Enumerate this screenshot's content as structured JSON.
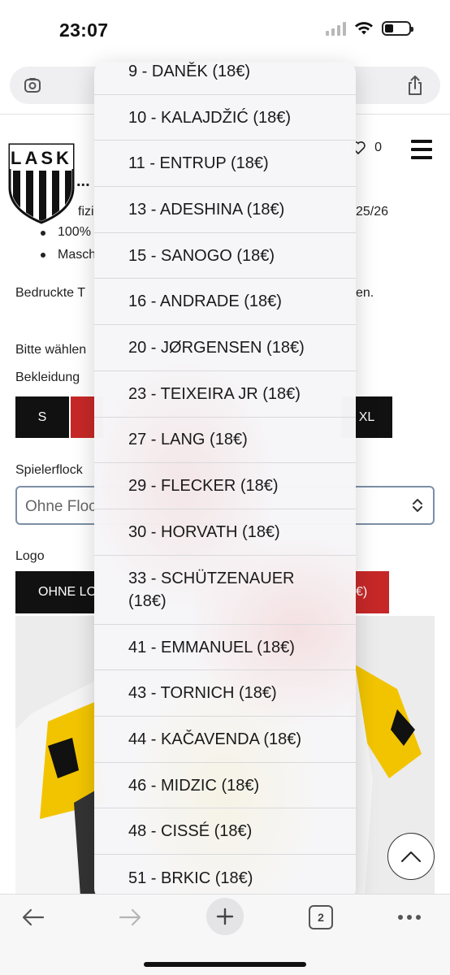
{
  "status_bar": {
    "time": "23:07",
    "battery_level": 0.35
  },
  "header": {
    "logo_text": "LASK",
    "favorites_count": "0"
  },
  "background_page": {
    "heading_fragment": "...",
    "spec_line_1_start": "fizie",
    "spec_line_1_end": "25/26",
    "spec_line_2_start": "100%",
    "spec_line_3_start": "Masch",
    "note_start": "Bedruckte T",
    "note_end": "en.",
    "choose_label": "Bitte wählen",
    "size_label": "Bekleidung",
    "sizes": [
      {
        "label": "S",
        "color": "#111111"
      },
      {
        "label": "",
        "color": "#c62828"
      },
      {
        "label": "XL",
        "color": "#111111"
      }
    ],
    "flock_label": "Spielerflock",
    "flock_select_value": "Ohne Floc",
    "logo_label": "Logo",
    "logo_option_1": "OHNE LO",
    "logo_option_2": "€)"
  },
  "dropdown": {
    "options": [
      "9 - DANĚK (18€)",
      "10 - KALAJDŽIĆ (18€)",
      "11 - ENTRUP (18€)",
      "13 - ADESHINA (18€)",
      "15 - SANOGO (18€)",
      "16 - ANDRADE (18€)",
      "20 - JØRGENSEN (18€)",
      "23 - TEIXEIRA JR (18€)",
      "27 - LANG (18€)",
      "29 - FLECKER (18€)",
      "30 - HORVATH (18€)",
      "33 - SCHÜTZENAUER (18€)",
      "41 - EMMANUEL (18€)",
      "43 - TORNICH (18€)",
      "44 - KAČAVENDA (18€)",
      "46 - MIDZIC (18€)",
      "48 - CISSÉ (18€)",
      "51 - BRKIC (18€)"
    ]
  },
  "toolbar": {
    "tab_count": "2"
  },
  "colors": {
    "accent_red": "#c62828",
    "black": "#111111",
    "jersey_yellow": "#f2c400"
  },
  "icons": [
    "reader-mode-icon",
    "share-icon",
    "heart-icon",
    "menu-icon",
    "chevron-updown-icon",
    "arrow-up-icon",
    "back-arrow-icon",
    "forward-arrow-icon",
    "plus-icon",
    "more-icon"
  ]
}
